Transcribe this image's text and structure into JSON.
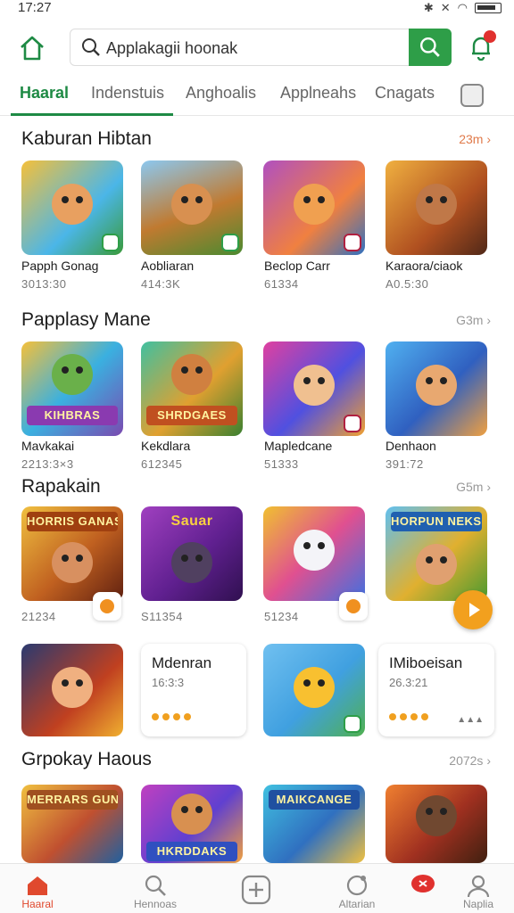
{
  "status_bar": {
    "time": "17:27"
  },
  "search": {
    "text": "Applakagii hoonak"
  },
  "tabs": [
    {
      "label": "Haaral"
    },
    {
      "label": "Indenstuis"
    },
    {
      "label": "Anghoalis"
    },
    {
      "label": "Applneahs"
    },
    {
      "label": "Cnagats"
    }
  ],
  "sections": [
    {
      "title": "Kaburan Hibtan",
      "more": "23m",
      "apps": [
        {
          "name": "Papph Gonag",
          "meta": "3013:30"
        },
        {
          "name": "Aobliaran",
          "meta": "414:3K"
        },
        {
          "name": "Beclop Carr",
          "meta": "61334"
        },
        {
          "name": "Karaora/ciaok",
          "meta": "A0.5:30"
        }
      ]
    },
    {
      "title": "Papplasy Mane",
      "more": "G3m",
      "apps": [
        {
          "name": "Mavkakai",
          "meta": "2213:3×3",
          "banner": "KIHBRAS"
        },
        {
          "name": "Kekdlara",
          "meta": "612345",
          "banner": "SHRDGAES"
        },
        {
          "name": "Mapledcane",
          "meta": "51333",
          "banner": ""
        },
        {
          "name": "Denhaon",
          "meta": "391:72",
          "banner": ""
        }
      ]
    },
    {
      "title": "Rapakain",
      "more": "G5m",
      "apps": [
        {
          "meta": "21234",
          "banner": "HORRIS GANAS"
        },
        {
          "meta": "S11354",
          "banner": "Sauar"
        },
        {
          "meta": "51234",
          "banner": ""
        },
        {
          "banner": "HORPUN NEKSN"
        }
      ]
    }
  ],
  "featured_row": [
    {
      "type": "image"
    },
    {
      "type": "card",
      "title": "Mdenran",
      "subtitle": "16:3:3"
    },
    {
      "type": "image"
    },
    {
      "type": "card",
      "title": "IMiboeisan",
      "subtitle": "26.3:21",
      "mini": "▲▲▲"
    }
  ],
  "bottom_section": {
    "title": "Grpokay Haous",
    "more": "2072s",
    "banners": [
      "MERRARS GUNES",
      "HKRDDAKS",
      "MAIKCANGE",
      ""
    ]
  },
  "bottom_nav": [
    {
      "label": "Haaral"
    },
    {
      "label": "Hennoas"
    },
    {
      "label": ""
    },
    {
      "label": "Altarian"
    },
    {
      "label": ""
    },
    {
      "label": "Naplia"
    }
  ],
  "colors": {
    "accent_green": "#1e8a44",
    "button_green": "#2e9e48",
    "nav_active": "#e0492e",
    "badge_red": "#e0312e",
    "fab_orange": "#f2a01e"
  }
}
